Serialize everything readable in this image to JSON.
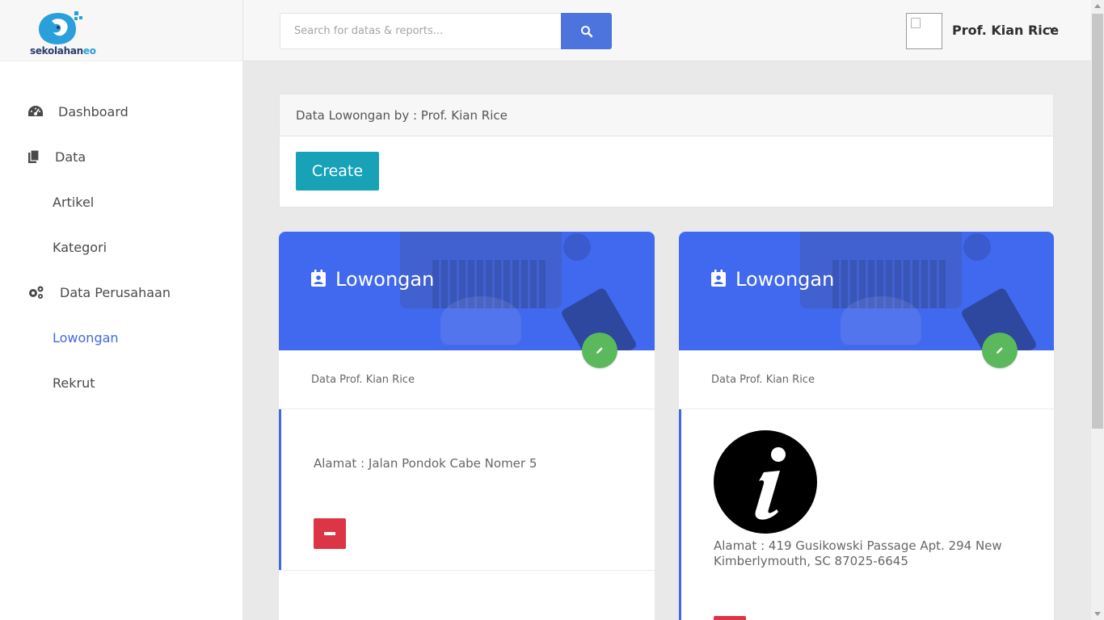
{
  "app": {
    "logo_text_main": "sekolahan",
    "logo_text_accent": "eo"
  },
  "sidebar": {
    "items": [
      {
        "label": "Dashboard",
        "icon": "dashboard-icon"
      },
      {
        "label": "Data",
        "icon": "copy-icon"
      },
      {
        "label": "Artikel"
      },
      {
        "label": "Kategori"
      },
      {
        "label": "Data Perusahaan",
        "icon": "cogs-icon"
      },
      {
        "label": "Lowongan",
        "active": true
      },
      {
        "label": "Rekrut"
      }
    ]
  },
  "topbar": {
    "search_placeholder": "Search for datas & reports...",
    "search_button_icon": "search-icon",
    "user_name": "Prof. Kian Rice"
  },
  "panel": {
    "heading": "Data Lowongan by : Prof. Kian Rice",
    "create_label": "Create"
  },
  "cards": [
    {
      "title": "Lowongan",
      "subtitle": "Data Prof. Kian Rice",
      "address": "Alamat : Jalan Pondok Cabe Nomer 5"
    },
    {
      "title": "Lowongan",
      "subtitle": "Data Prof. Kian Rice",
      "address": "Alamat : 419 Gusikowski Passage Apt. 294 New Kimberlymouth, SC 87025-6645"
    }
  ],
  "colors": {
    "accent": "#4169e1",
    "banner": "#4169f0",
    "create": "#17a2b8",
    "edit": "#5cb85c",
    "delete": "#dc3545"
  }
}
